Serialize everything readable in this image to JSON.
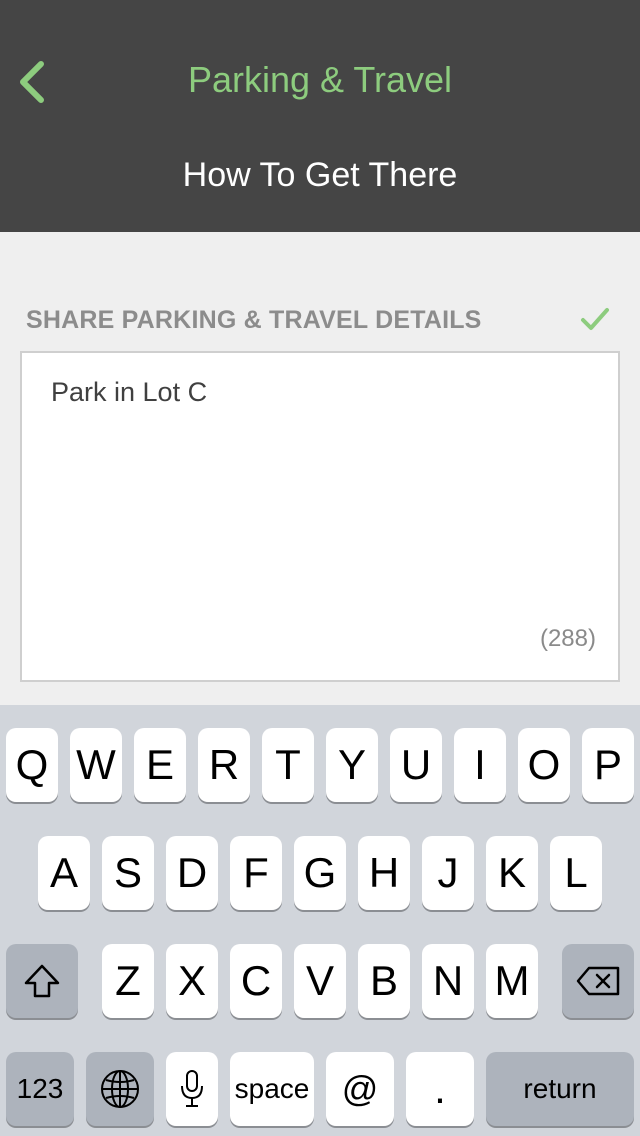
{
  "header": {
    "back_icon": "chevron-left-icon",
    "title": "Parking & Travel",
    "subtitle": "How To Get There"
  },
  "section": {
    "label": "SHARE PARKING & TRAVEL DETAILS",
    "check_icon": "checkmark-icon"
  },
  "textarea": {
    "value": "Park in Lot C",
    "char_count": "(288)"
  },
  "keyboard": {
    "row1": [
      "Q",
      "W",
      "E",
      "R",
      "T",
      "Y",
      "U",
      "I",
      "O",
      "P"
    ],
    "row2": [
      "A",
      "S",
      "D",
      "F",
      "G",
      "H",
      "J",
      "K",
      "L"
    ],
    "row3": [
      "Z",
      "X",
      "C",
      "V",
      "B",
      "N",
      "M"
    ],
    "numbers_label": "123",
    "space_label": "space",
    "at_label": "@",
    "period_label": ".",
    "return_label": "return",
    "icons": [
      "shift-icon",
      "backspace-icon",
      "globe-icon",
      "microphone-icon"
    ]
  },
  "colors": {
    "header_bg": "#454545",
    "accent_green": "#8dcc7e",
    "page_bg": "#efefef",
    "keyboard_bg": "#d1d5db"
  }
}
